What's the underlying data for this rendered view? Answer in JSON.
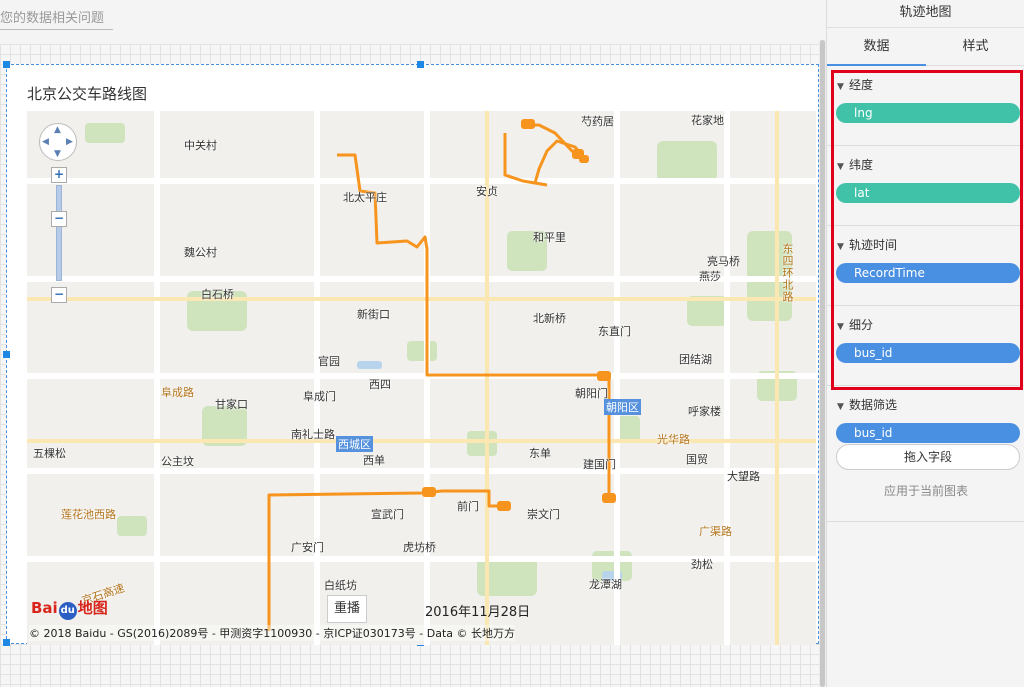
{
  "query": {
    "placeholder": "您的数据相关问题"
  },
  "widget": {
    "title": "北京公交车路线图",
    "replay_label": "重播",
    "date_label": "2016年11月28日",
    "copyright": "© 2018 Baidu - GS(2016)2089号 - 甲测资字1100930 - 京ICP证030173号 - Data © 长地万方",
    "logo_text": "Bai",
    "logo_du": "du",
    "logo_suffix": "地图",
    "zoom_in": "+",
    "zoom_out": "−",
    "places": [
      {
        "name": "芍药居"
      },
      {
        "name": "花家地"
      },
      {
        "name": "中关村"
      },
      {
        "name": "北太平庄"
      },
      {
        "name": "安贞"
      },
      {
        "name": "和平里"
      },
      {
        "name": "魏公村"
      },
      {
        "name": "亮马桥"
      },
      {
        "name": "燕莎"
      },
      {
        "name": "白石桥"
      },
      {
        "name": "新街口"
      },
      {
        "name": "北新桥"
      },
      {
        "name": "东直门"
      },
      {
        "name": "官园"
      },
      {
        "name": "团结湖"
      },
      {
        "name": "西四"
      },
      {
        "name": "朝阳门"
      },
      {
        "name": "甘家口"
      },
      {
        "name": "阜成门"
      },
      {
        "name": "呼家楼"
      },
      {
        "name": "南礼士路"
      },
      {
        "name": "五棵松"
      },
      {
        "name": "公主坟"
      },
      {
        "name": "西单"
      },
      {
        "name": "东单"
      },
      {
        "name": "建国门"
      },
      {
        "name": "国贸"
      },
      {
        "name": "大望路"
      },
      {
        "name": "前门"
      },
      {
        "name": "崇文门"
      },
      {
        "name": "宣武门"
      },
      {
        "name": "广安门"
      },
      {
        "name": "虎坊桥"
      },
      {
        "name": "劲松"
      },
      {
        "name": "白纸坊"
      },
      {
        "name": "龙潭湖"
      }
    ],
    "roads": [
      {
        "name": "阜成路"
      },
      {
        "name": "光华路"
      },
      {
        "name": "莲花池西路"
      },
      {
        "name": "广渠路"
      },
      {
        "name": "京石高速"
      }
    ],
    "districts": [
      {
        "name": "西城区"
      },
      {
        "name": "朝阳区"
      }
    ],
    "vertical_road": "东四环北路"
  },
  "panel": {
    "title": "轨迹地图",
    "tabs": [
      {
        "label": "数据"
      },
      {
        "label": "样式"
      }
    ],
    "sections": [
      {
        "label": "经度",
        "field": "lng",
        "color": "#3fc2a7"
      },
      {
        "label": "纬度",
        "field": "lat",
        "color": "#3fc2a7"
      },
      {
        "label": "轨迹时间",
        "field": "RecordTime",
        "color": "#4a90e2"
      },
      {
        "label": "细分",
        "field": "bus_id",
        "color": "#4a90e2"
      }
    ],
    "filter": {
      "label": "数据筛选",
      "field": "bus_id",
      "drop_label": "拖入字段",
      "apply_label": "应用于当前图表"
    }
  },
  "colors": {
    "route": "#f7941d",
    "accent": "#4a90e2",
    "highlight_box": "#e0001b"
  }
}
